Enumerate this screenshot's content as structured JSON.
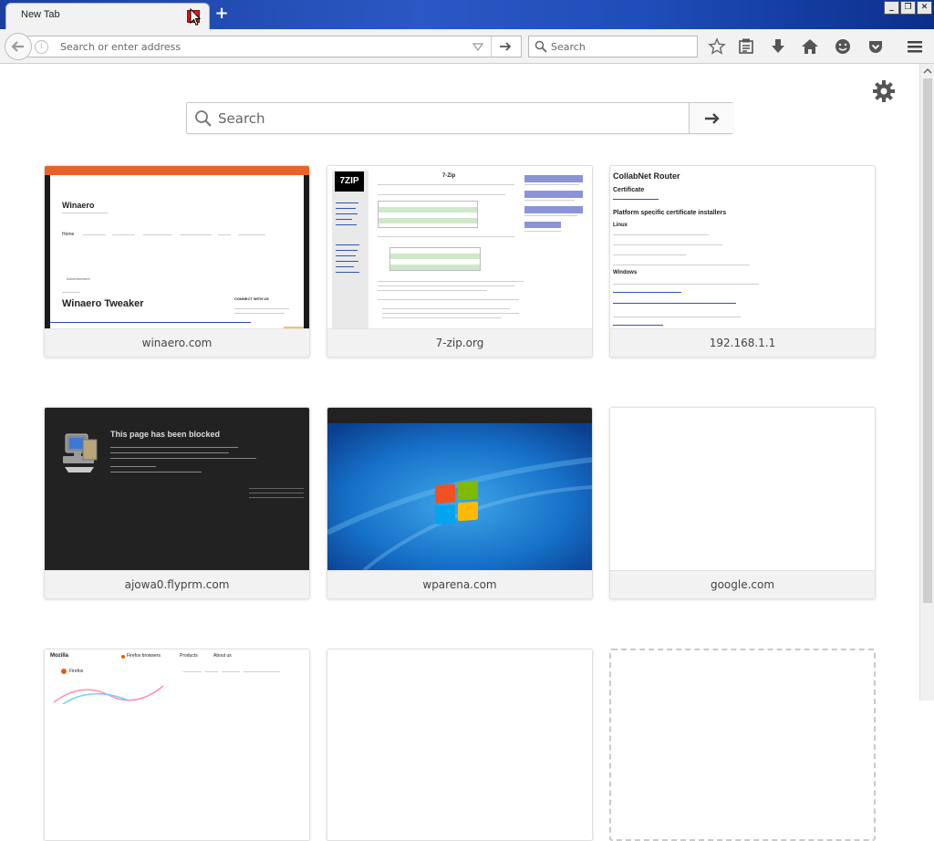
{
  "tabs": [
    {
      "title": "New Tab"
    }
  ],
  "window_controls": {
    "minimize": "_",
    "restore": "❐",
    "close": "✕"
  },
  "urlbar": {
    "placeholder": "Search or enter address"
  },
  "searchbar": {
    "placeholder": "Search"
  },
  "toolbar_icons": [
    "back-icon",
    "info-icon",
    "dropdown-icon",
    "go-arrow-icon",
    "search-icon",
    "bookmark-star-icon",
    "reading-list-icon",
    "download-icon",
    "home-icon",
    "hello-icon",
    "pocket-icon",
    "menu-icon"
  ],
  "newtab": {
    "search_placeholder": "Search",
    "tiles": [
      {
        "label": "winaero.com"
      },
      {
        "label": "7-zip.org"
      },
      {
        "label": "192.168.1.1"
      },
      {
        "label": "ajowa0.flyprm.com"
      },
      {
        "label": "wparena.com"
      },
      {
        "label": "google.com"
      }
    ]
  },
  "thumbs": {
    "winaero": {
      "title": "Winaero",
      "headline": "Winaero Tweaker",
      "nav_home": "Home",
      "connect": "CONNECT WITH US",
      "ad": "Advertisement"
    },
    "sevenzip": {
      "logo": "7ZIP",
      "title": "7-Zip"
    },
    "router": {
      "title": "CollabNet Router",
      "h1": "Certificate",
      "h2": "Platform specific certificate installers",
      "h3": "Linux",
      "h4": "Windows"
    },
    "blocked": {
      "title": "This page has been blocked"
    },
    "mozilla": {
      "brand": "Mozilla",
      "firefox": "Firefox",
      "nav1": "Firefox browsers",
      "nav2": "Products",
      "nav3": "About us"
    }
  }
}
